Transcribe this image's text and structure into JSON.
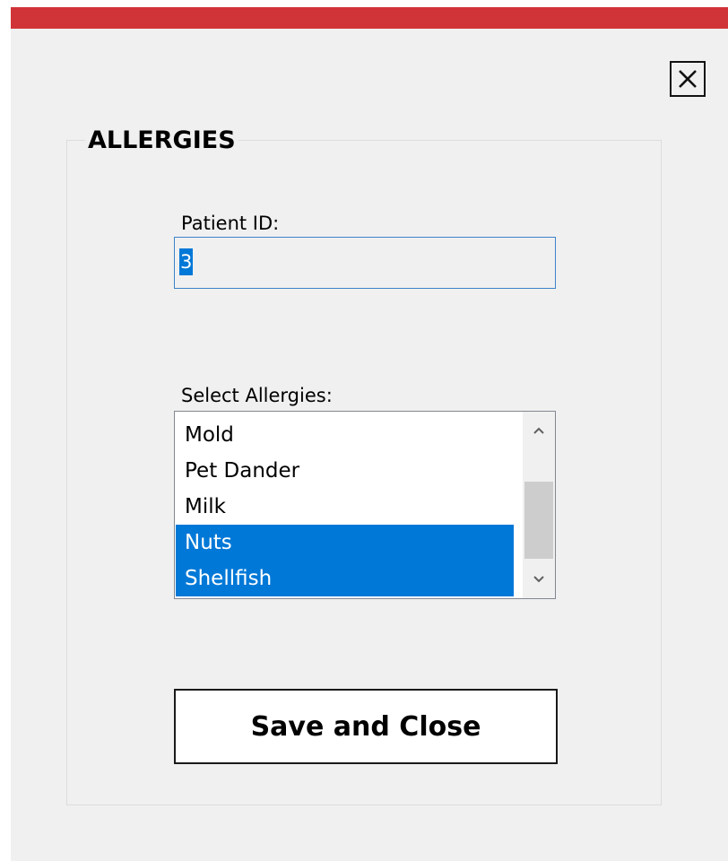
{
  "window": {
    "title_bar_color": "#d13438",
    "background": "#f0f0f0"
  },
  "close_icon": "close-icon",
  "group": {
    "title": "ALLERGIES"
  },
  "patient_id": {
    "label": "Patient ID:",
    "value": "3"
  },
  "allergies": {
    "label": "Select Allergies:",
    "items": [
      {
        "label": "Mold",
        "selected": false
      },
      {
        "label": "Pet Dander",
        "selected": false
      },
      {
        "label": "Milk",
        "selected": false
      },
      {
        "label": "Nuts",
        "selected": true
      },
      {
        "label": "Shellfish",
        "selected": true
      }
    ],
    "selection_color": "#0078d7"
  },
  "buttons": {
    "save_label": "Save and Close"
  }
}
